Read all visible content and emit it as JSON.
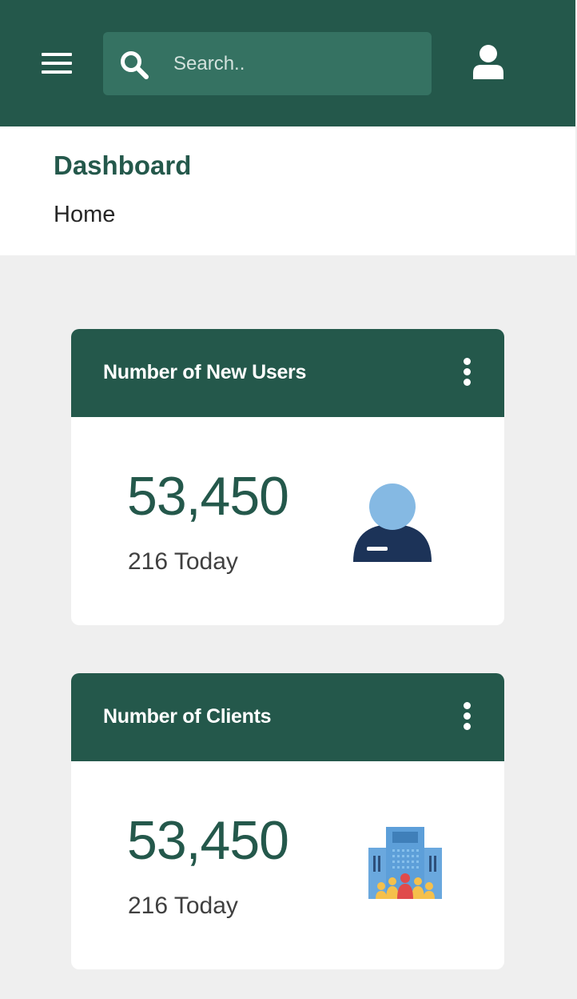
{
  "topbar": {
    "search": {
      "placeholder": "Search..",
      "value": ""
    },
    "icons": {
      "menu": "hamburger-menu-icon",
      "search": "search-icon",
      "account": "user-account-icon"
    }
  },
  "page": {
    "title": "Dashboard",
    "breadcrumb": "Home"
  },
  "cards": [
    {
      "title": "Number of New Users",
      "value": "53,450",
      "subtext": "216 Today",
      "icon": "new-user-icon"
    },
    {
      "title": "Number of Clients",
      "value": "53,450",
      "subtext": "216 Today",
      "icon": "clients-building-icon"
    }
  ],
  "colors": {
    "primary": "#24584b",
    "search_bg": "#357262",
    "background": "#efefef",
    "card": "#ffffff",
    "user_head": "#85b9e3",
    "user_body": "#1c3358",
    "building": "#5d9fd9",
    "people_red": "#e04b4b",
    "people_yellow": "#f5c04c"
  }
}
